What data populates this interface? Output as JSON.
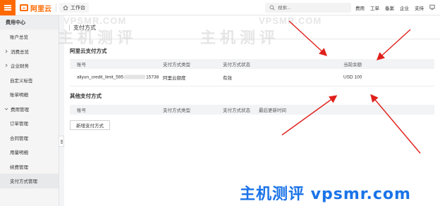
{
  "topbar": {
    "logo_text": "阿里云",
    "workbench_label": "工作台",
    "search_placeholder": "搜索...",
    "nav": [
      "费用",
      "工单",
      "备案",
      "企业",
      "支持"
    ]
  },
  "sidebar": {
    "title": "费用中心",
    "items": [
      {
        "label": "账户总览",
        "group": false
      },
      {
        "label": "消费总览",
        "group": true
      },
      {
        "label": "企业财务",
        "group": true
      },
      {
        "label": "自定义标签",
        "group": false
      },
      {
        "label": "账单明细",
        "group": false
      },
      {
        "label": "费用管理",
        "group": true
      },
      {
        "label": "订单管理",
        "group": false
      },
      {
        "label": "合同管理",
        "group": false
      },
      {
        "label": "用量明细",
        "group": false
      },
      {
        "label": "续费管理",
        "group": false
      },
      {
        "label": "支付方式管理",
        "group": false,
        "active": true
      }
    ]
  },
  "main": {
    "page_title": "支付方式",
    "aliyun_section": {
      "title": "阿里云支付方式",
      "headers": [
        "账号",
        "支付方式类型",
        "支付方式状态",
        "当前余额"
      ],
      "rows": [
        {
          "account_prefix": "aliyun_credit_limit_595",
          "account_suffix": "15738",
          "type": "阿里云额度",
          "status": "有效",
          "balance": "USD 100"
        }
      ]
    },
    "other_section": {
      "title": "其他支付方式",
      "headers": [
        "账号",
        "支付方式类型",
        "支付方式状态",
        "最后更新时间"
      ],
      "add_button": "新增支付方式"
    }
  },
  "watermarks": {
    "top_left": "VPSMR.COM",
    "top_right": "VPSMR.COM",
    "cn": "主机测评",
    "bottom": "主机测评 vpsmr.com"
  },
  "colors": {
    "brand": "#ff6a00",
    "arrow": "#e0201b",
    "watermark_blue": "#1a73e8"
  }
}
